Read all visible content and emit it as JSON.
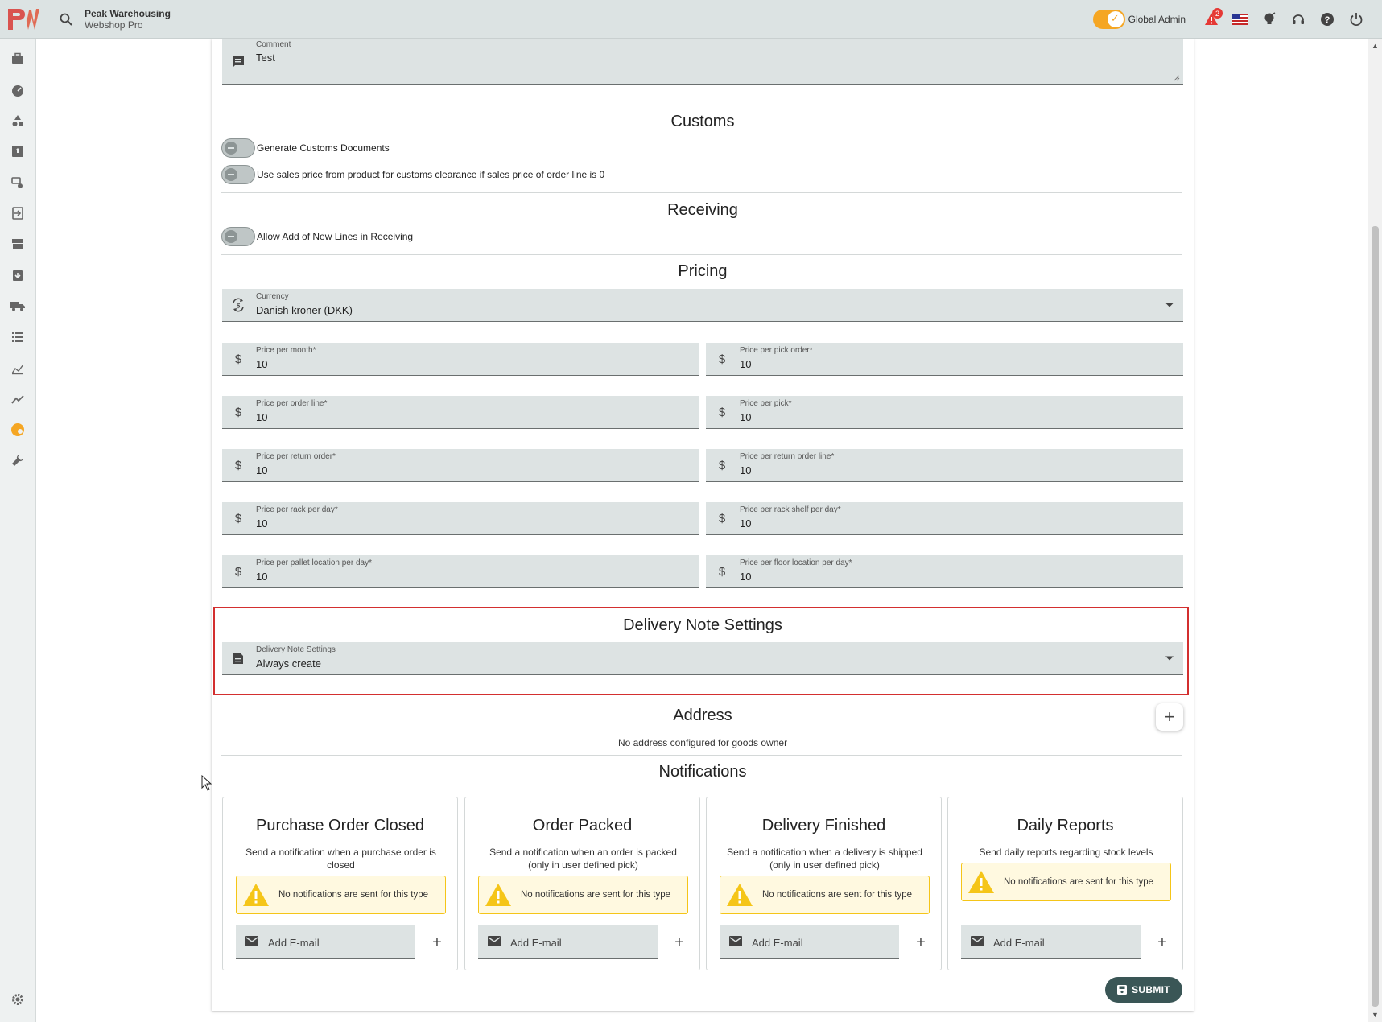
{
  "header": {
    "brand_name": "Peak Warehousing",
    "brand_sub": "Webshop Pro",
    "admin_label": "Global Admin",
    "notification_count": "2",
    "logo_text": "PW"
  },
  "sidebar": {
    "icons": [
      "briefcase-icon",
      "dashboard-icon",
      "shapes-icon",
      "inbox-upload-icon",
      "route-icon",
      "import-icon",
      "store-icon",
      "clipboard-down-icon",
      "truck-icon",
      "list-numbered-icon",
      "bar-chart-icon",
      "trend-line-icon",
      "goods-owner-icon",
      "wrench-icon",
      "settings-icon"
    ]
  },
  "comment": {
    "label": "Comment",
    "value": "Test"
  },
  "customs": {
    "title": "Customs",
    "generate_docs_label": "Generate Customs Documents",
    "use_sales_price_label": "Use sales price from product for customs clearance if sales price of order line is 0"
  },
  "receiving": {
    "title": "Receiving",
    "allow_new_lines_label": "Allow Add of New Lines in Receiving"
  },
  "pricing": {
    "title": "Pricing",
    "currency_label": "Currency",
    "currency_value": "Danish kroner (DKK)",
    "fields": [
      {
        "label": "Price per month*",
        "value": "10"
      },
      {
        "label": "Price per pick order*",
        "value": "10"
      },
      {
        "label": "Price per order line*",
        "value": "10"
      },
      {
        "label": "Price per pick*",
        "value": "10"
      },
      {
        "label": "Price per return order*",
        "value": "10"
      },
      {
        "label": "Price per return order line*",
        "value": "10"
      },
      {
        "label": "Price per rack per day*",
        "value": "10"
      },
      {
        "label": "Price per rack shelf per day*",
        "value": "10"
      },
      {
        "label": "Price per pallet location per day*",
        "value": "10"
      },
      {
        "label": "Price per floor location per day*",
        "value": "10"
      }
    ]
  },
  "delivery_note": {
    "title": "Delivery Note Settings",
    "label": "Delivery Note Settings",
    "value": "Always create",
    "highlight_color": "#d32f2f"
  },
  "address": {
    "title": "Address",
    "empty_text": "No address configured for goods owner"
  },
  "notifications": {
    "title": "Notifications",
    "cards": [
      {
        "title": "Purchase Order Closed",
        "desc": "Send a notification when a purchase order is closed",
        "warning": "No notifications are sent for this type",
        "email_placeholder": "Add E-mail"
      },
      {
        "title": "Order Packed",
        "desc": "Send a notification when an order is packed (only in user defined pick)",
        "warning": "No notifications are sent for this type",
        "email_placeholder": "Add E-mail"
      },
      {
        "title": "Delivery Finished",
        "desc": "Send a notification when a delivery is shipped (only in user defined pick)",
        "warning": "No notifications are sent for this type",
        "email_placeholder": "Add E-mail"
      },
      {
        "title": "Daily Reports",
        "desc": "Send daily reports regarding stock levels",
        "warning": "No notifications are sent for this type",
        "email_placeholder": "Add E-mail"
      }
    ]
  },
  "submit_label": "SUBMIT",
  "colors": {
    "accent": "#f5a623",
    "primary_button": "#3a5656",
    "field_bg": "#dde3e3",
    "warning_bg": "#fff9e0",
    "warning_border": "#f5c518"
  }
}
